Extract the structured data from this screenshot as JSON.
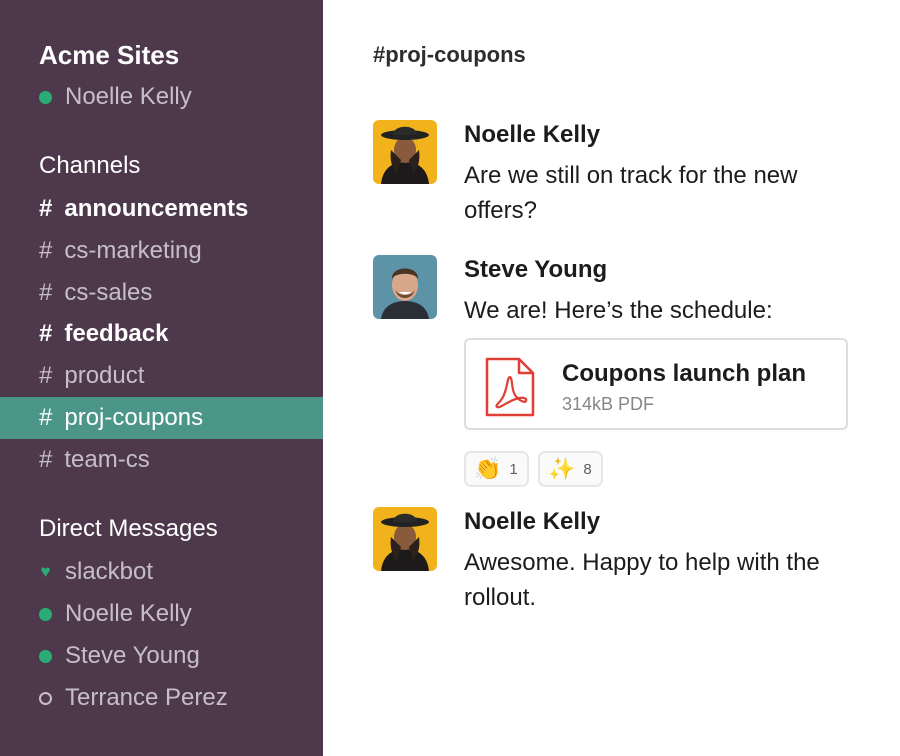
{
  "workspace": {
    "name": "Acme Sites",
    "current_user": "Noelle Kelly"
  },
  "sidebar": {
    "channels_heading": "Channels",
    "channels": [
      {
        "label": "announcements",
        "hash": "#",
        "state": "unread"
      },
      {
        "label": "cs-marketing",
        "hash": "#",
        "state": "read"
      },
      {
        "label": "cs-sales",
        "hash": "#",
        "state": "read"
      },
      {
        "label": "feedback",
        "hash": "#",
        "state": "unread"
      },
      {
        "label": "product",
        "hash": "#",
        "state": "read"
      },
      {
        "label": "proj-coupons",
        "hash": "#",
        "state": "active"
      },
      {
        "label": "team-cs",
        "hash": "#",
        "state": "read"
      }
    ],
    "dm_heading": "Direct Messages",
    "dms": [
      {
        "label": "slackbot",
        "status": "heart"
      },
      {
        "label": "Noelle Kelly",
        "status": "online"
      },
      {
        "label": "Steve Young",
        "status": "online"
      },
      {
        "label": "Terrance Perez",
        "status": "away"
      }
    ]
  },
  "main": {
    "channel_title": "#proj-coupons",
    "messages": [
      {
        "author": "Noelle Kelly",
        "text": "Are we still on track for the new offers?"
      },
      {
        "author": "Steve Young",
        "text": "We are! Here’s the schedule:"
      },
      {
        "author": "Noelle Kelly",
        "text": "Awesome. Happy to help with the rollout."
      }
    ],
    "attachment": {
      "name": "Coupons launch plan",
      "meta": "314kB PDF",
      "icon": "pdf-icon"
    },
    "reactions": [
      {
        "emoji": "👏",
        "count": "1",
        "icon": "clap-emoji"
      },
      {
        "emoji": "✨",
        "count": "8",
        "icon": "sparkles-emoji"
      }
    ]
  },
  "colors": {
    "sidebar_bg": "#4d394b",
    "active_channel": "#4c9689",
    "online": "#2bac76",
    "pdf_red": "#e03e36"
  }
}
